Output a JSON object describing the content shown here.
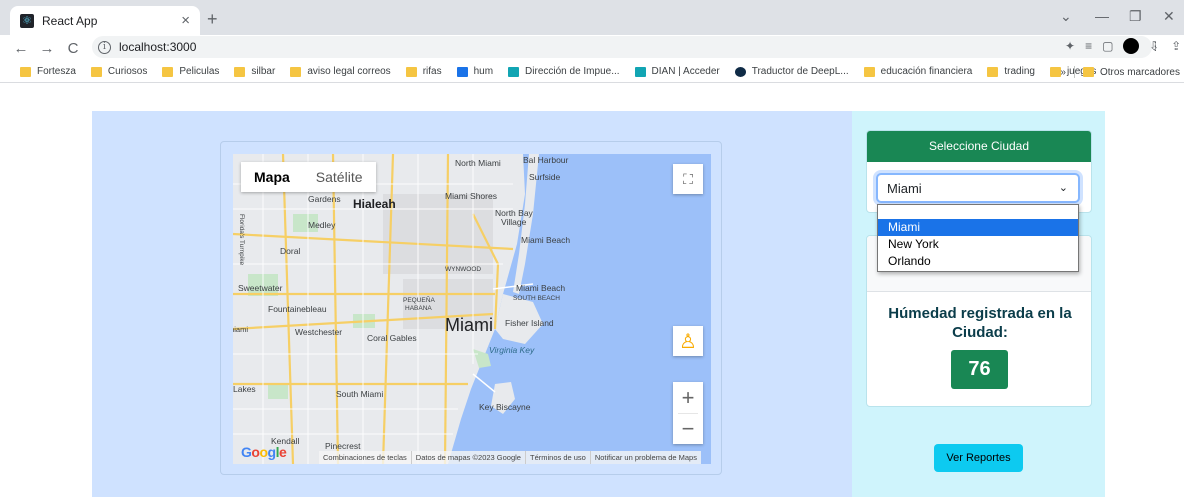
{
  "browser": {
    "tab_title": "React App",
    "tab_close": "×",
    "new_tab": "+",
    "url": "localhost:3000",
    "nav": {
      "back": "←",
      "forward": "→",
      "reload": "C"
    }
  },
  "bookmarks": [
    {
      "label": "Fortesza",
      "icon": "folder-icon"
    },
    {
      "label": "Curiosos",
      "icon": "folder-icon"
    },
    {
      "label": "Peliculas",
      "icon": "folder-icon"
    },
    {
      "label": "silbar",
      "icon": "folder-icon"
    },
    {
      "label": "aviso legal correos",
      "icon": "folder-icon"
    },
    {
      "label": "rifas",
      "icon": "folder-icon"
    },
    {
      "label": "hum",
      "icon": "site-icon"
    },
    {
      "label": "Dirección de Impue...",
      "icon": "site-icon"
    },
    {
      "label": "DIAN | Acceder",
      "icon": "site-icon"
    },
    {
      "label": "Traductor de DeepL...",
      "icon": "deepl-icon"
    },
    {
      "label": "educación financiera",
      "icon": "folder-icon"
    },
    {
      "label": "trading",
      "icon": "folder-icon"
    },
    {
      "label": "juegos",
      "icon": "folder-icon"
    }
  ],
  "bookmarks_overflow": "»",
  "other_bookmarks": "Otros marcadores",
  "map": {
    "type_map": "Mapa",
    "type_satellite": "Satélite",
    "center_label": "Miami",
    "labels": [
      "North Miami",
      "Bal Harbour",
      "Surfside",
      "Gardens",
      "Hialeah",
      "Miami Shores",
      "North Bay Village",
      "Medley",
      "Miami Beach",
      "Doral",
      "WYNWOOD",
      "Sweetwater",
      "Fountainebleau",
      "PEQUEÑA HABANA",
      "SOUTH BEACH",
      "Westchester",
      "Fisher Island",
      "Coral Gables",
      "Virginia Key",
      "Lakes",
      "South Miami",
      "Key Biscayne",
      "Kendall",
      "Pinecrest",
      "Florida's Turnpike"
    ],
    "attribution": [
      "Combinaciones de teclas",
      "Datos de mapas ©2023 Google",
      "Términos de uso",
      "Notificar un problema de Maps"
    ],
    "google_logo": "Google",
    "zoom_in": "+",
    "zoom_out": "−"
  },
  "city": {
    "header": "Seleccione Ciudad",
    "selected": "Miami",
    "options": [
      "Miami",
      "New York",
      "Orlando"
    ]
  },
  "humidity": {
    "title": "Húmedad registrada en la Ciudad:",
    "value": "76"
  },
  "reports_button": "Ver Reportes"
}
